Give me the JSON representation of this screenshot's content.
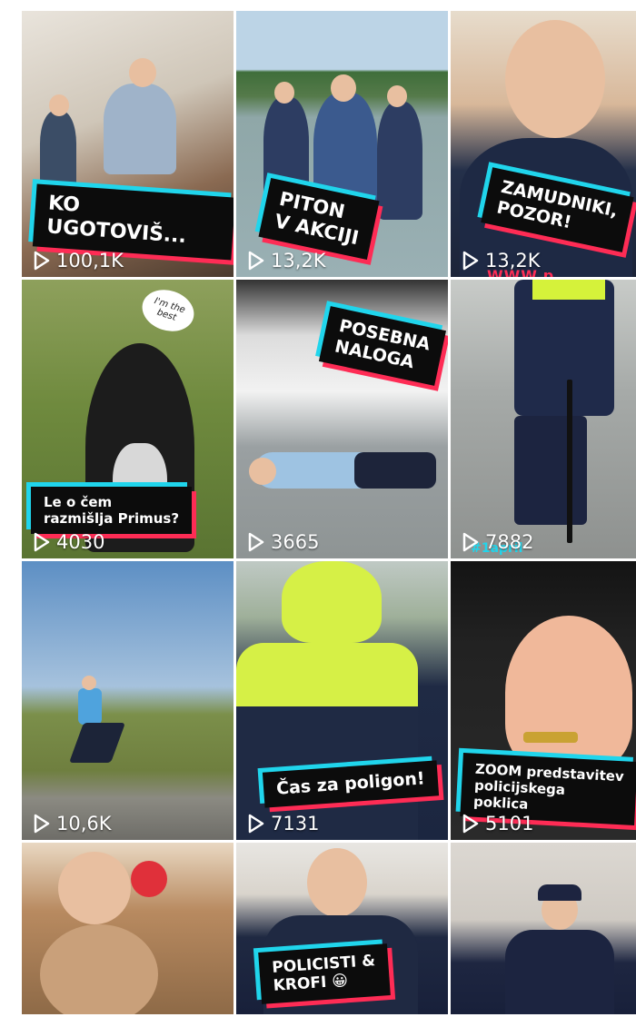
{
  "grid": {
    "tiles": [
      {
        "caption": "KO UGOTOVIŠ...",
        "views": "100,1K"
      },
      {
        "caption": "PITON\nV AKCIJI",
        "views": "13,2K"
      },
      {
        "caption": "ZAMUDNIKI,\nPOZOR!",
        "views": "13,2K",
        "logo": "WWW.p"
      },
      {
        "caption": "Le o čem\nrazmišlja Primus?",
        "views": "4030",
        "bubble": "I'm the best"
      },
      {
        "caption": "POSEBNA\nNALOGA",
        "views": "3665"
      },
      {
        "caption": "",
        "views": "7882",
        "tag": "#1april"
      },
      {
        "caption": "",
        "views": "10,6K"
      },
      {
        "caption": "Čas za poligon!",
        "views": "7131"
      },
      {
        "caption": "ZOOM predstavitev\npolicijskega poklica",
        "views": "5101"
      },
      {
        "caption": "",
        "views": ""
      },
      {
        "caption": "POLICISTI &\nKROFI 😀",
        "views": ""
      },
      {
        "caption": "",
        "views": ""
      }
    ]
  },
  "icons": {
    "play": "play-outline-icon"
  },
  "colors": {
    "caption_bg": "#0c0c0c",
    "accent_cyan": "#20d5ec",
    "accent_pink": "#fe2c55"
  }
}
